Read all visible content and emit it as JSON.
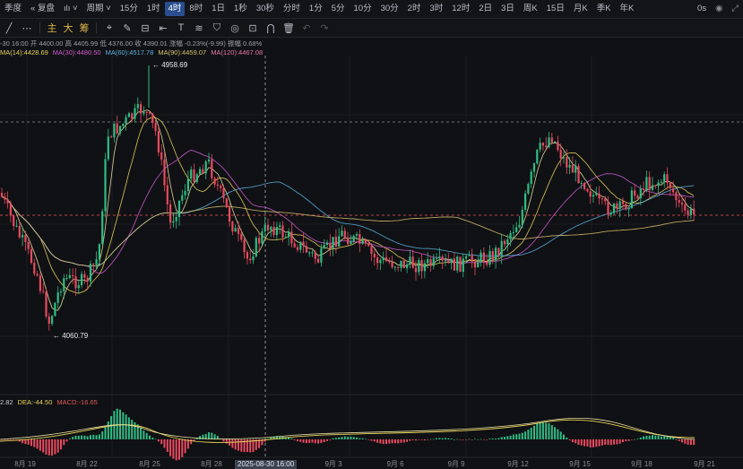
{
  "toolbar": {
    "symbol": "季度",
    "restore": "复盘",
    "chart_icon": "ılı",
    "period": "周期",
    "intervals": [
      "15分",
      "1时",
      "4时",
      "8时",
      "1日",
      "1秒",
      "30秒",
      "分时",
      "1分",
      "5分",
      "10分",
      "30分",
      "2时",
      "3时",
      "12时",
      "2日",
      "3日",
      "周K",
      "15日",
      "月K",
      "季K",
      "年K"
    ],
    "active_interval": "4时",
    "time_right": "0s"
  },
  "toolbar2": {
    "main": "主",
    "sub": "大",
    "chips": "筹"
  },
  "ohlc_line": "-30 16:00  开 4400.00  高 4405.99  低 4376.00  收 4390.01  涨幅 -0.23%(-9.99)  振幅 0.68%",
  "ma_legend": [
    {
      "label": "MA(14):4428.69",
      "color": "#e7d25a"
    },
    {
      "label": "MA(30):4480.50",
      "color": "#d05ad0"
    },
    {
      "label": "MA(60):4517.78",
      "color": "#5ab0e0"
    },
    {
      "label": "MA(90):4459.07",
      "color": "#d8c070"
    },
    {
      "label": "MA(120):4467.08",
      "color": "#e87aa0"
    }
  ],
  "macd_legend": [
    {
      "label": "2.82",
      "color": "#c9ccd2"
    },
    {
      "label": "DEA:-44.50",
      "color": "#e7d25a"
    },
    {
      "label": "MACD:-16.65",
      "color": "#e05a5a"
    }
  ],
  "annotations": {
    "high": "4958.69",
    "low": "4060.79"
  },
  "x_labels": [
    "8月 19",
    "8月 22",
    "8月 25",
    "8月 28",
    "9月 3",
    "9月 6",
    "9月 9",
    "9月 12",
    "9月 15",
    "9月 18",
    "9月 21"
  ],
  "x_highlight": "2025-08-30 16:00",
  "colors": {
    "up": "#2ebd85",
    "down": "#e84a5f",
    "bg": "#101114"
  }
}
